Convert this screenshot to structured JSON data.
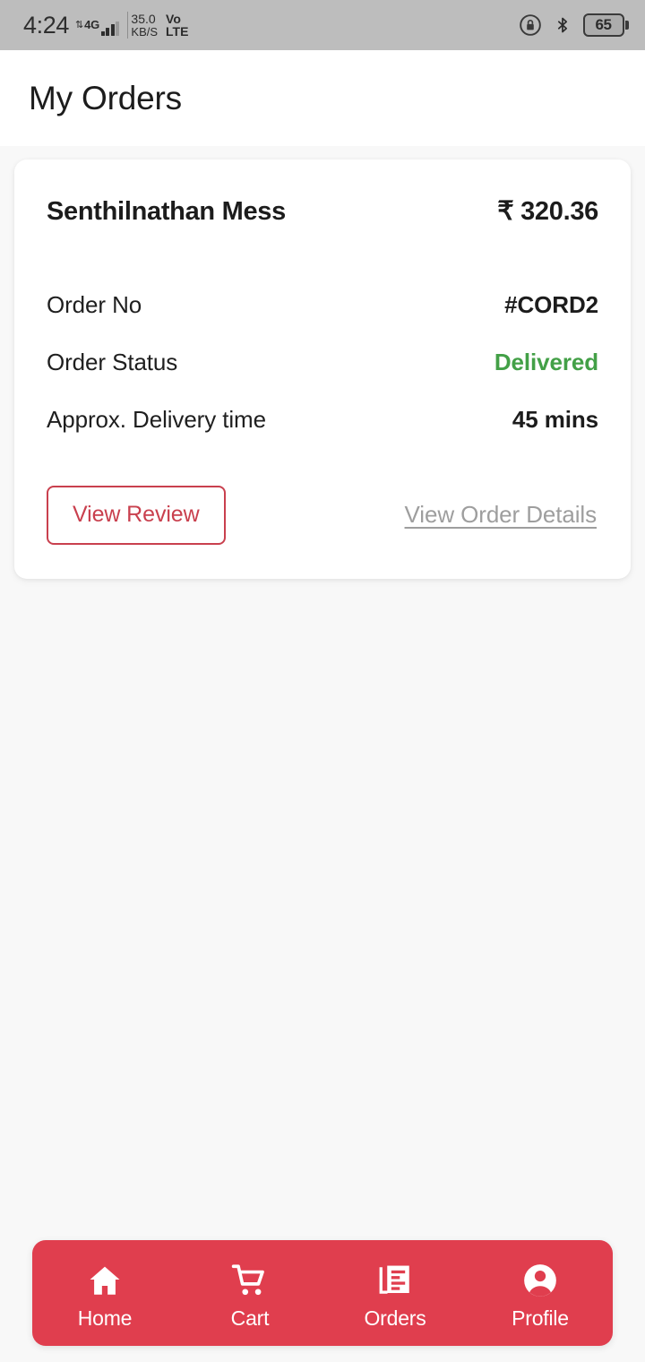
{
  "status_bar": {
    "time": "4:24",
    "network_type": "4G",
    "data_speed_value": "35.0",
    "data_speed_unit": "KB/S",
    "volte_line1": "Vo",
    "volte_line2": "LTE",
    "battery_percent": "65",
    "icons": [
      "rotation-lock-icon",
      "bluetooth-icon",
      "battery-icon"
    ],
    "bg_color": "#bdbdbd"
  },
  "header": {
    "title": "My Orders"
  },
  "order_card": {
    "shop_name": "Senthilnathan Mess",
    "amount": "₹ 320.36",
    "details": [
      {
        "label": "Order No",
        "value": "#CORD2"
      },
      {
        "label": "Order Status",
        "value": "Delivered"
      },
      {
        "label": "Approx. Delivery time",
        "value": "45 mins"
      }
    ],
    "review_button_label": "View Review",
    "order_details_link_label": "View Order Details",
    "status_color": "#43a047",
    "accent_color": "#c9404e",
    "link_color": "#9e9e9e"
  },
  "bottom_nav": {
    "bg_color": "#e03e4e",
    "items": [
      {
        "label": "Home",
        "icon": "home-icon"
      },
      {
        "label": "Cart",
        "icon": "cart-icon"
      },
      {
        "label": "Orders",
        "icon": "orders-icon"
      },
      {
        "label": "Profile",
        "icon": "profile-icon"
      }
    ]
  }
}
